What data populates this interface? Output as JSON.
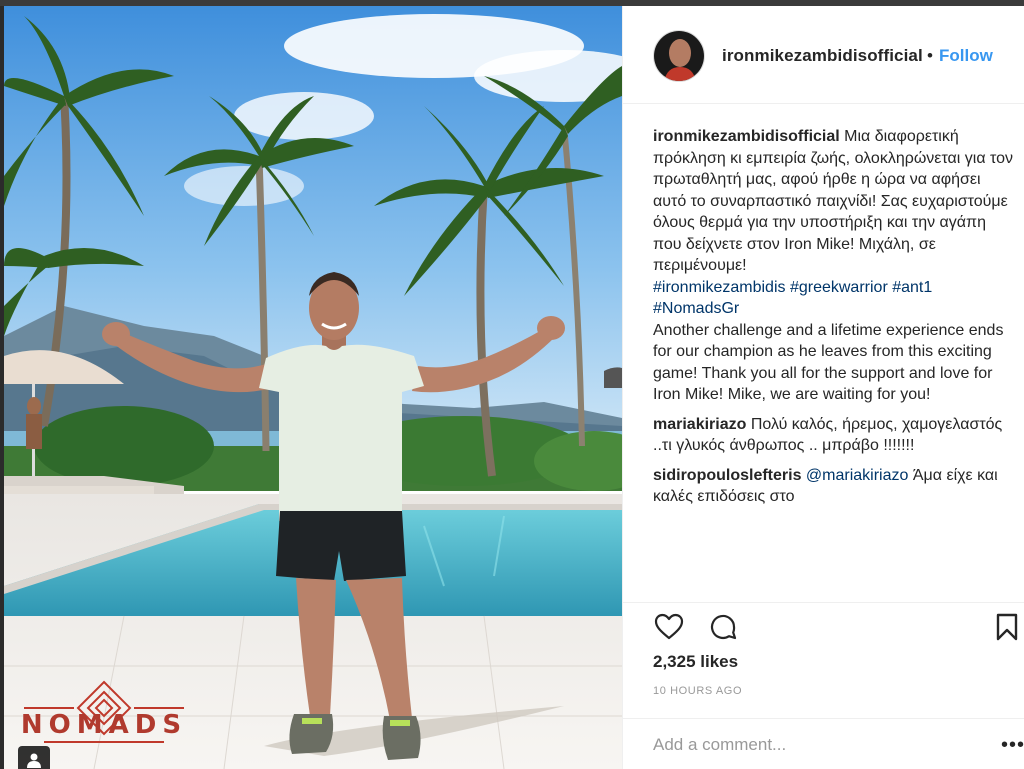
{
  "post": {
    "username": "ironmikezambidisofficial",
    "separator": "•",
    "follow_label": "Follow",
    "likes": "2,325 likes",
    "time": "10 HOURS AGO",
    "comment_placeholder": "Add a comment...",
    "watermark": "NOMADS"
  },
  "caption": {
    "user": "ironmikezambidisofficial",
    "text_gr": "Μια διαφορετική πρόκληση κι εμπειρία ζωής, ολοκληρώνεται για τον πρωταθλητή μας, αφού ήρθε η ώρα να αφήσει αυτό το συναρπαστικό παιχνίδι! Σας ευχαριστούμε όλους θερμά για την υποστήριξη και την αγάπη που δείχνετε στον Iron Mike! Μιχάλη, σε περιμένουμε!",
    "hashtags": [
      "#ironmikezambidis",
      "#greekwarrior",
      "#ant1",
      "#NomadsGr"
    ],
    "text_en": "Another challenge and a lifetime experience ends for our champion as he leaves from this exciting game! Thank you all for the support and love for Iron Mike! Mike, we are waiting for you!"
  },
  "comments": [
    {
      "user": "mariakiriazo",
      "mention": "",
      "text": "Πολύ καλός, ήρεμος, χαμογελαστός ..τι γλυκός άνθρωπος .. μπράβο !!!!!!!"
    },
    {
      "user": "sidiropouloslefteris",
      "mention": "@mariakiriazo",
      "text": "Άμα είχε και καλές επιδόσεις στο"
    }
  ],
  "icons": {
    "like": "heart-icon",
    "comment": "comment-icon",
    "save": "bookmark-icon",
    "more": "more-options-icon",
    "user_tag": "user-tag-icon"
  },
  "colors": {
    "follow": "#3897f0",
    "hashtag": "#003569",
    "sky": "#5fa8e8",
    "pool": "#4fb3c9"
  }
}
